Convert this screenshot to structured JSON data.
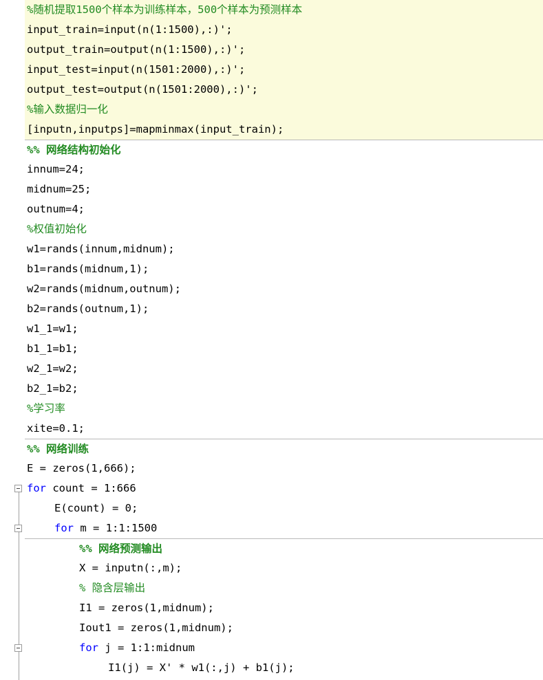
{
  "colors": {
    "comment": "#228b22",
    "keyword": "#0000ff",
    "text": "#000000",
    "active_cell_bg": "#fbfbdc",
    "cell_separator": "#b8b8b8"
  },
  "icons": {
    "fold": "fold-collapse-icon"
  },
  "lines": [
    {
      "kind": "comment",
      "text": "%随机提取1500个样本为训练样本，500个样本为预测样本"
    },
    {
      "kind": "code",
      "text": "input_train=input(n(1:1500),:)';"
    },
    {
      "kind": "code",
      "text": "output_train=output(n(1:1500),:)';"
    },
    {
      "kind": "code",
      "text": "input_test=input(n(1501:2000),:)';"
    },
    {
      "kind": "code",
      "text": "output_test=output(n(1501:2000),:)';"
    },
    {
      "kind": "comment",
      "text": "%输入数据归一化"
    },
    {
      "kind": "code",
      "text": "[inputn,inputps]=mapminmax(input_train);"
    },
    {
      "kind": "cell-title",
      "text": "%% 网络结构初始化"
    },
    {
      "kind": "code",
      "text": "innum=24;"
    },
    {
      "kind": "code",
      "text": "midnum=25;"
    },
    {
      "kind": "code",
      "text": "outnum=4;"
    },
    {
      "kind": "comment",
      "text": "%权值初始化"
    },
    {
      "kind": "code",
      "text": "w1=rands(innum,midnum);"
    },
    {
      "kind": "code",
      "text": "b1=rands(midnum,1);"
    },
    {
      "kind": "code",
      "text": "w2=rands(midnum,outnum);"
    },
    {
      "kind": "code",
      "text": "b2=rands(outnum,1);"
    },
    {
      "kind": "code",
      "text": "w1_1=w1;"
    },
    {
      "kind": "code",
      "text": "b1_1=b1;"
    },
    {
      "kind": "code",
      "text": "w2_1=w2;"
    },
    {
      "kind": "code",
      "text": "b2_1=b2;"
    },
    {
      "kind": "comment",
      "text": "%学习率"
    },
    {
      "kind": "code",
      "text": "xite=0.1;"
    },
    {
      "kind": "cell-title",
      "text": "%% 网络训练"
    },
    {
      "kind": "code",
      "text": "E = zeros(1,666);"
    },
    {
      "kind": "loop",
      "keyword": "for",
      "text": " count = 1:666"
    },
    {
      "kind": "code",
      "text": "E(count) = 0;"
    },
    {
      "kind": "loop",
      "keyword": "for",
      "text": " m = 1:1:1500"
    },
    {
      "kind": "cell-title",
      "text": "%% 网络预测输出"
    },
    {
      "kind": "code",
      "text": "X = inputn(:,m);"
    },
    {
      "kind": "comment",
      "text": "% 隐含层输出"
    },
    {
      "kind": "code",
      "text": "I1 = zeros(1,midnum);"
    },
    {
      "kind": "code",
      "text": "Iout1 = zeros(1,midnum);"
    },
    {
      "kind": "loop",
      "keyword": "for",
      "text": " j = 1:1:midnum"
    },
    {
      "kind": "code",
      "text": "I1(j) = X' * w1(:,j) + b1(j);"
    }
  ]
}
